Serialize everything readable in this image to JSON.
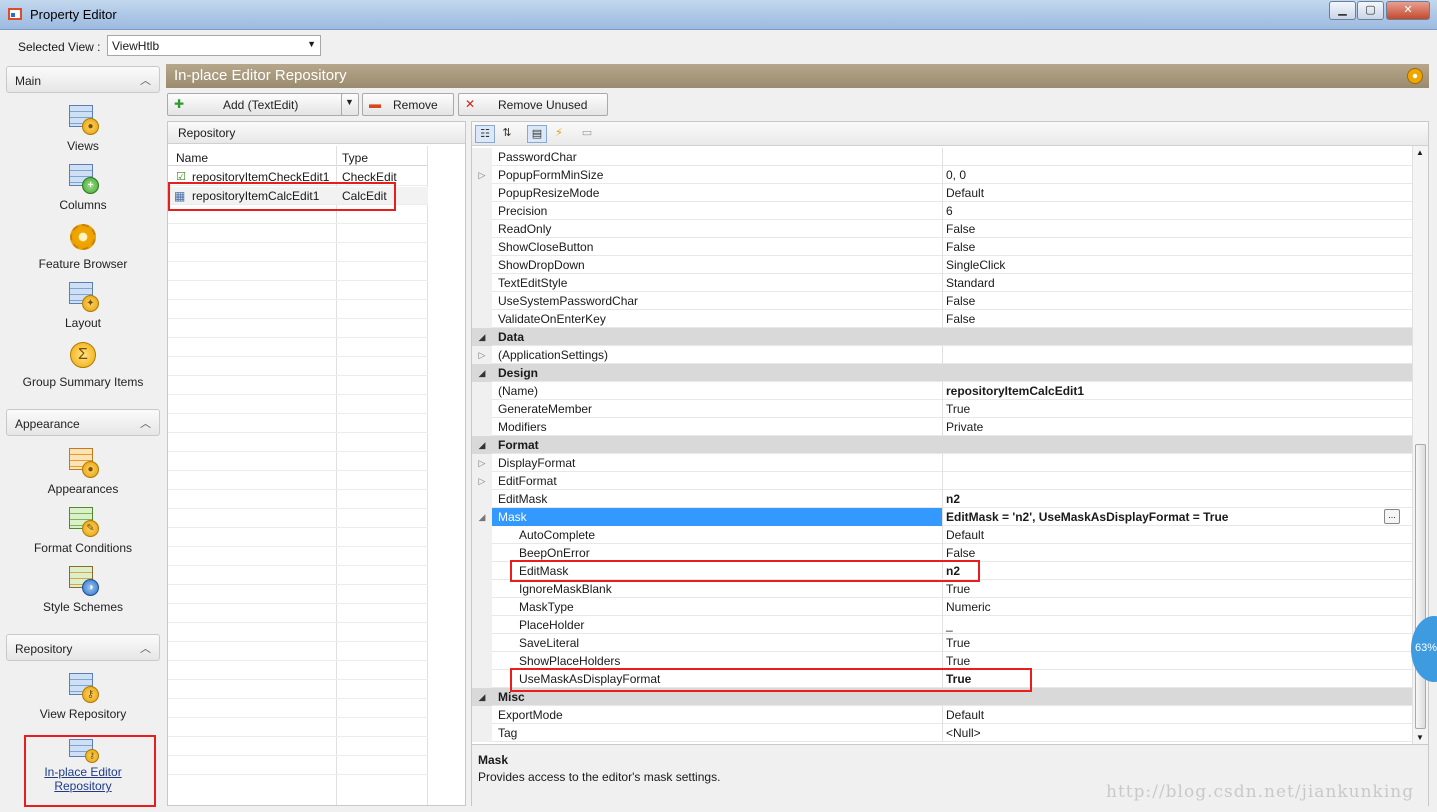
{
  "window": {
    "title": "Property Editor",
    "minimize": "▁",
    "maximize": "▢",
    "close": "✕"
  },
  "view_selector": {
    "label": "Selected View :",
    "value": "ViewHtlb"
  },
  "nav": {
    "groups": [
      {
        "label": "Main",
        "items": [
          "Views",
          "Columns",
          "Feature Browser",
          "Layout",
          "Group Summary Items"
        ]
      },
      {
        "label": "Appearance",
        "items": [
          "Appearances",
          "Format Conditions",
          "Style Schemes"
        ]
      },
      {
        "label": "Repository",
        "items": [
          "View Repository",
          "In-place Editor Repository"
        ]
      }
    ],
    "caret": "︿"
  },
  "header": {
    "title": "In-place Editor Repository"
  },
  "toolbar": {
    "add_label": "Add (TextEdit)",
    "remove_label": "Remove",
    "remove_unused_label": "Remove Unused"
  },
  "repository": {
    "caption": "Repository",
    "columns": [
      "Name",
      "Type"
    ],
    "rows": [
      {
        "name": "repositoryItemCheckEdit1",
        "type": "CheckEdit"
      },
      {
        "name": "repositoryItemCalcEdit1",
        "type": "CalcEdit"
      }
    ]
  },
  "property_grid": {
    "rows": [
      {
        "name": "PasswordChar",
        "value": ""
      },
      {
        "name": "PopupFormMinSize",
        "value": "0, 0",
        "expandable": true
      },
      {
        "name": "PopupResizeMode",
        "value": "Default"
      },
      {
        "name": "Precision",
        "value": "6"
      },
      {
        "name": "ReadOnly",
        "value": "False"
      },
      {
        "name": "ShowCloseButton",
        "value": "False"
      },
      {
        "name": "ShowDropDown",
        "value": "SingleClick"
      },
      {
        "name": "TextEditStyle",
        "value": "Standard"
      },
      {
        "name": "UseSystemPasswordChar",
        "value": "False"
      },
      {
        "name": "ValidateOnEnterKey",
        "value": "False"
      },
      {
        "category": "Data"
      },
      {
        "name": "(ApplicationSettings)",
        "value": "",
        "expandable": true
      },
      {
        "category": "Design"
      },
      {
        "name": "(Name)",
        "value": "repositoryItemCalcEdit1",
        "bold": true
      },
      {
        "name": "GenerateMember",
        "value": "True"
      },
      {
        "name": "Modifiers",
        "value": "Private"
      },
      {
        "category": "Format"
      },
      {
        "name": "DisplayFormat",
        "value": "",
        "expandable": true
      },
      {
        "name": "EditFormat",
        "value": "",
        "expandable": true
      },
      {
        "name": "EditMask",
        "value": "n2",
        "bold": true
      },
      {
        "name": "Mask",
        "value": "EditMask = 'n2', UseMaskAsDisplayFormat = True",
        "bold": true,
        "selected": true,
        "expanded": true
      },
      {
        "name": "AutoComplete",
        "value": "Default",
        "child": true
      },
      {
        "name": "BeepOnError",
        "value": "False",
        "child": true
      },
      {
        "name": "EditMask",
        "value": "n2",
        "bold": true,
        "child": true
      },
      {
        "name": "IgnoreMaskBlank",
        "value": "True",
        "child": true
      },
      {
        "name": "MaskType",
        "value": "Numeric",
        "child": true
      },
      {
        "name": "PlaceHolder",
        "value": "_",
        "child": true
      },
      {
        "name": "SaveLiteral",
        "value": "True",
        "child": true
      },
      {
        "name": "ShowPlaceHolders",
        "value": "True",
        "child": true
      },
      {
        "name": "UseMaskAsDisplayFormat",
        "value": "True",
        "bold": true,
        "child": true
      },
      {
        "category": "Misc"
      },
      {
        "name": "ExportMode",
        "value": "Default"
      },
      {
        "name": "Tag",
        "value": "<Null>"
      }
    ],
    "description": {
      "title": "Mask",
      "text": "Provides access to the editor's mask settings."
    }
  },
  "overlay": {
    "percent_badge": "63%"
  },
  "watermark": "http://blog.csdn.net/jiankunking"
}
